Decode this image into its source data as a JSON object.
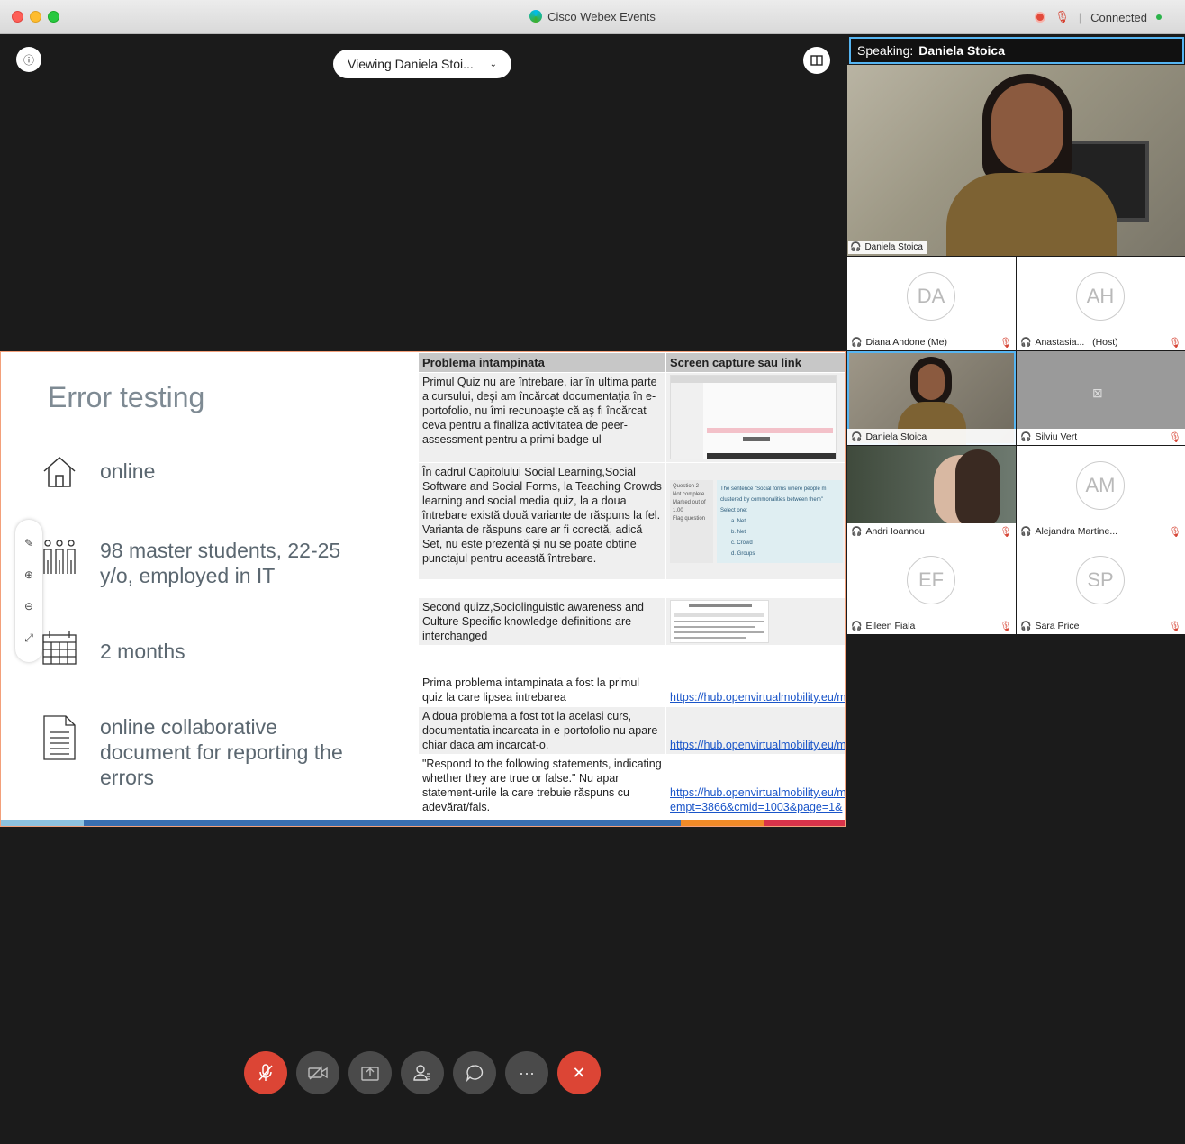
{
  "window": {
    "title": "Cisco Webex Events",
    "status": "Connected"
  },
  "stage": {
    "viewing_label": "Viewing Daniela Stoi...",
    "info_icon": "info-icon",
    "layout_icon": "layout-icon"
  },
  "slide": {
    "title": "Error testing",
    "items": [
      {
        "icon": "home-icon",
        "text": "online"
      },
      {
        "icon": "people-icon",
        "text": "98 master students, 22-25 y/o, employed in IT"
      },
      {
        "icon": "calendar-icon",
        "text": "2 months"
      },
      {
        "icon": "document-icon",
        "text": "online collaborative document for reporting the errors"
      }
    ],
    "table": {
      "headers": [
        "Problema intampinata",
        "Screen capture sau link"
      ],
      "rows": [
        {
          "problem": "Primul Quiz nu are întrebare, iar în ultima parte a cursului, deşi am încărcat documentaţia în e-portofolio, nu îmi recunoaşte că aş fi încărcat ceva pentru a finaliza activitatea de peer-assessment pentru a primi badge-ul",
          "capture": ""
        },
        {
          "problem": "În cadrul Capitolului Social Learning,Social Software and Social Forms, la Teaching Crowds learning and social media quiz, la a doua întrebare există două variante de răspuns la fel. Varianta de răspuns care ar fi corectă, adică Set, nu este prezentă și nu se poate obține punctajul pentru această întrebare.",
          "capture": ""
        },
        {
          "problem": "",
          "capture": ""
        },
        {
          "problem": "Second quizz,Sociolinguistic awareness and Culture Specific knowledge definitions are interchanged",
          "capture": ""
        },
        {
          "problem": "Prima problema intampinata a fost la primul quiz la care lipsea intrebarea",
          "capture": "https://hub.openvirtualmobility.eu/m"
        },
        {
          "problem": "A doua problema a fost tot la acelasi curs, documentatia incarcata in e-portofolio nu apare chiar daca am incarcat-o.",
          "capture": "https://hub.openvirtualmobility.eu/m"
        },
        {
          "problem": "\"Respond to the following statements, indicating whether they are true or false.\" Nu apar statement-urile la care trebuie răspuns cu adevărat/fals.",
          "capture": "https://hub.openvirtualmobility.eu/m",
          "capture2": "empt=3866&cmid=1003&page=1&"
        }
      ]
    },
    "quiz_preview": {
      "question_label": "Question 2",
      "status": "Not complete",
      "marked": "Marked out of 1.00",
      "flag": "Flag question",
      "prompt": "The sentence \"Social forms where people m clustered by commonalities between them\"",
      "select": "Select one:",
      "options": [
        "a. Net",
        "b. Net",
        "c. Crowd",
        "d. Groups"
      ]
    },
    "footer_colors": [
      "#8ec3e0",
      "#3a6fb0",
      "#f08a28",
      "#d8334a"
    ]
  },
  "controls": [
    {
      "name": "mute-button",
      "icon": "mic-off-icon"
    },
    {
      "name": "video-button",
      "icon": "video-off-icon"
    },
    {
      "name": "share-button",
      "icon": "share-icon"
    },
    {
      "name": "participants-button",
      "icon": "participants-icon"
    },
    {
      "name": "chat-button",
      "icon": "chat-icon"
    },
    {
      "name": "more-button",
      "icon": "more-icon",
      "label": "···"
    },
    {
      "name": "leave-button",
      "icon": "close-icon",
      "label": "✕"
    }
  ],
  "panel": {
    "speaking_prefix": "Speaking:",
    "speaking_name": "Daniela Stoica",
    "main_name": "Daniela Stoica",
    "participants": [
      {
        "initials": "DA",
        "name": "Diana Andone",
        "suffix": "(Me)",
        "muted": true,
        "video": false
      },
      {
        "initials": "AH",
        "name": "Anastasia...",
        "suffix": "(Host)",
        "muted": true,
        "video": false
      },
      {
        "initials": "",
        "name": "Daniela Stoica",
        "suffix": "",
        "muted": false,
        "video": true
      },
      {
        "initials": "",
        "name": "Silviu Vert",
        "suffix": "",
        "muted": true,
        "video": false,
        "camera_off": true
      },
      {
        "initials": "",
        "name": "Andri Ioannou",
        "suffix": "",
        "muted": true,
        "video": true
      },
      {
        "initials": "AM",
        "name": "Alejandra Martíne...",
        "suffix": "",
        "muted": true,
        "video": false
      },
      {
        "initials": "EF",
        "name": "Eileen Fiala",
        "suffix": "",
        "muted": true,
        "video": false
      },
      {
        "initials": "SP",
        "name": "Sara Price",
        "suffix": "",
        "muted": true,
        "video": false
      }
    ]
  }
}
